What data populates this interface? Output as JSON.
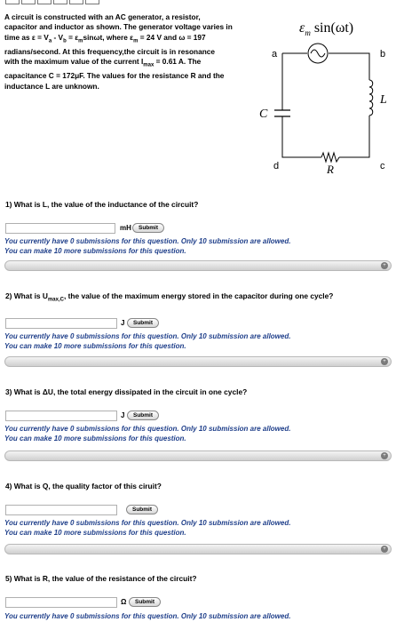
{
  "intro": {
    "line1": "A circuit is constructed with an AC generator, a resistor,",
    "line2": "capacitor and inductor as shown. The generator voltage varies in",
    "line3_a": "time as ε = V",
    "line3_sub_a": "a",
    "line3_b": " - V",
    "line3_sub_b": "b",
    "line3_c": " = ε",
    "line3_sub_c": "m",
    "line3_d": "sinωt, where ε",
    "line3_sub_d": "m",
    "line3_e": " = 24 V and ω = 197",
    "line4": "radians/second. At this frequency,the circuit is in resonance",
    "line5_a": "with the maximum value of the current I",
    "line5_sub": "max",
    "line5_b": " = 0.61 A. The",
    "line6": "capacitance C = 172μF. The values for the resistance R and the",
    "line7": "inductance L are unknown."
  },
  "diagram": {
    "source_label": "ε",
    "source_label_sub": "m",
    "source_expr": "sin(ωt)",
    "node_a": "a",
    "node_b": "b",
    "node_c": "c",
    "node_d": "d",
    "cap_label": "C",
    "ind_label": "L",
    "res_label": "R"
  },
  "questions": [
    {
      "text": "1) What is L, the value of the inductance of the circuit?",
      "unit": "mH",
      "submit_label": "Submit",
      "input_value": "",
      "status_line1": "You currently have 0 submissions for this question. Only 10 submission are allowed.",
      "status_line2": "You can make 10 more submissions for this question."
    },
    {
      "text_a": "2) What is U",
      "text_sub": "max,C",
      "text_b": ", the value of the maximum energy stored in the capacitor during one cycle?",
      "unit": "J",
      "submit_label": "Submit",
      "input_value": "",
      "status_line1": "You currently have 0 submissions for this question. Only 10 submission are allowed.",
      "status_line2": "You can make 10 more submissions for this question."
    },
    {
      "text": "3) What is ΔU, the total energy dissipated in the circuit in one cycle?",
      "unit": "J",
      "submit_label": "Submit",
      "input_value": "",
      "status_line1": "You currently have 0 submissions for this question. Only 10 submission are allowed.",
      "status_line2": "You can make 10 more submissions for this question."
    },
    {
      "text": "4) What is Q, the quality factor of this ciruit?",
      "unit": "",
      "submit_label": "Submit",
      "input_value": "",
      "status_line1": "You currently have 0 submissions for this question. Only 10 submission are allowed.",
      "status_line2": "You can make 10 more submissions for this question."
    },
    {
      "text": "5) What is R, the value of the resistance of the circuit?",
      "unit": "Ω",
      "submit_label": "Submit",
      "input_value": "",
      "status_line1": "You currently have 0 submissions for this question. Only 10 submission are allowed."
    }
  ],
  "expand_icon": "plus-circle-icon",
  "colors": {
    "status_text": "#1f3f8a",
    "bar_top": "#f4f4f4",
    "bar_bottom": "#cfcfcf"
  }
}
